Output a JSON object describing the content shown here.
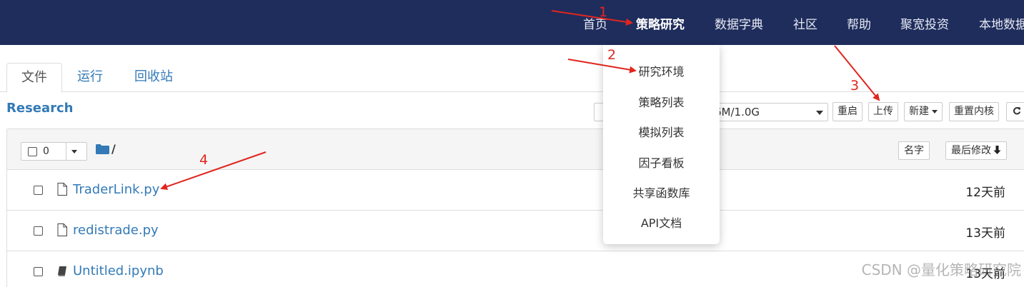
{
  "nav": {
    "items": [
      "首页",
      "策略研究",
      "数据字典",
      "社区",
      "帮助",
      "聚宽投资",
      "本地数据"
    ],
    "active_index": 1
  },
  "tabs": [
    "文件",
    "运行",
    "回收站"
  ],
  "active_tab": 0,
  "research_title": "Research",
  "toolbar": {
    "kernel_value": "6M/1.0G",
    "restart": "重启",
    "upload": "上传",
    "new": "新建",
    "restart_kernel": "重置内核",
    "refresh_icon": "refresh-icon"
  },
  "list_header": {
    "selected_count": "0",
    "breadcrumb": "/",
    "sort_name": "名字",
    "sort_modified": "最后修改"
  },
  "files": [
    {
      "name": "TraderLink.py",
      "modified": "12天前",
      "icon": "file-icon"
    },
    {
      "name": "redistrade.py",
      "modified": "13天前",
      "icon": "file-icon"
    },
    {
      "name": "Untitled.ipynb",
      "modified": "13天前",
      "icon": "notebook-icon"
    }
  ],
  "dropdown": {
    "items": [
      "研究环境",
      "策略列表",
      "模拟列表",
      "因子看板",
      "共享函数库",
      "API文档"
    ]
  },
  "annotations": {
    "labels": [
      "1",
      "2",
      "3",
      "4"
    ],
    "color": "#e0261e"
  },
  "watermark": "CSDN @量化策略研究院",
  "colors": {
    "navbar": "#1f2d5c",
    "link": "#337ab7"
  }
}
